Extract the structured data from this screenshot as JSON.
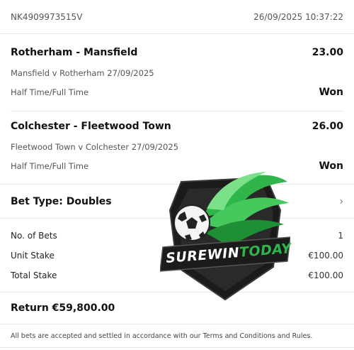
{
  "header": {
    "ref": "NK4909973515V",
    "timestamp": "26/09/2025 10:37:22"
  },
  "selections": [
    {
      "title": "Rotherham - Mansfield",
      "odds": "23.00",
      "event": "Mansfield v Rotherham 27/09/2025",
      "market": "Half Time/Full Time",
      "result": "Won"
    },
    {
      "title": "Colchester - Fleetwood Town",
      "odds": "26.00",
      "event": "Fleetwood Town v Colchester 27/09/2025",
      "market": "Half Time/Full Time",
      "result": "Won"
    }
  ],
  "bet_type": {
    "label": "Bet Type: Doubles",
    "chevron_icon": "chevron-right-icon"
  },
  "stakes": {
    "no_of_bets_label": "No. of Bets",
    "no_of_bets_value": "1",
    "unit_stake_label": "Unit Stake",
    "unit_stake_value": "€100.00",
    "total_stake_label": "Total Stake",
    "total_stake_value": "€100.00"
  },
  "return_text": "Return €59,800.00",
  "footer": "All bets are accepted and settled in accordance with our Terms and Conditions and Rules.",
  "watermark": {
    "text_part1": "SUREWIN",
    "text_part2": "TODAY",
    "icon": "football-icon"
  },
  "colors": {
    "brand_green": "#2fb54a",
    "shield_dark": "#1b1b1b",
    "won_text": "#111111"
  }
}
